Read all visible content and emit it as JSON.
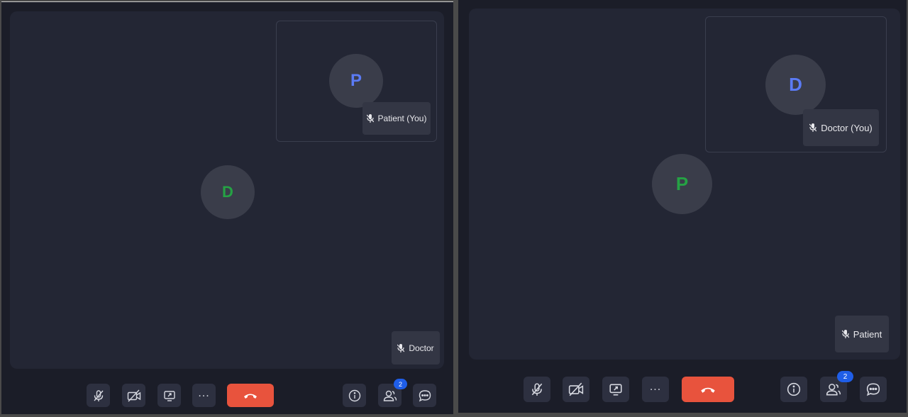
{
  "left_window": {
    "main_participant": {
      "initial": "D",
      "name": "Doctor"
    },
    "self_view": {
      "initial": "P",
      "name": "Patient (You)"
    },
    "participant_count": "2"
  },
  "right_window": {
    "main_participant": {
      "initial": "P",
      "name": "Patient"
    },
    "self_view": {
      "initial": "D",
      "name": "Doctor (You)"
    },
    "participant_count": "2"
  },
  "toolbar_icons": [
    "mic-off-icon",
    "camera-off-icon",
    "share-screen-icon",
    "more-options-icon",
    "end-call-icon",
    "info-icon",
    "participants-icon",
    "chat-icon"
  ],
  "colors": {
    "end_call": "#e8533d",
    "badge": "#1f5ee8",
    "avatar_blue": "#5b7bf5",
    "avatar_green": "#25a244"
  }
}
